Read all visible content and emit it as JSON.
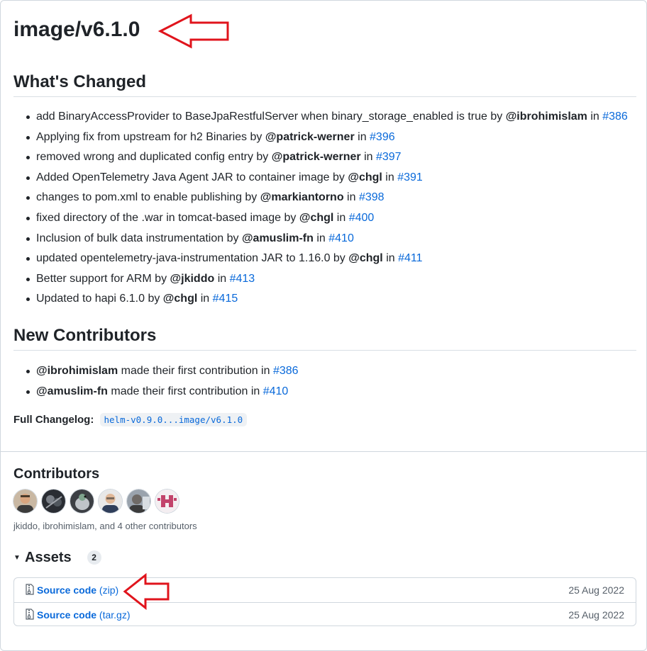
{
  "release": {
    "title": "image/v6.1.0"
  },
  "whats_changed": {
    "heading": "What's Changed",
    "items": [
      {
        "text": "add BinaryAccessProvider to BaseJpaRestfulServer when binary_storage_enabled is true by ",
        "author": "@ibrohimislam",
        "in": " in ",
        "pr": "#386"
      },
      {
        "text": "Applying fix from upstream for h2 Binaries by ",
        "author": "@patrick-werner",
        "in": " in ",
        "pr": "#396"
      },
      {
        "text": "removed wrong and duplicated config entry by ",
        "author": "@patrick-werner",
        "in": " in ",
        "pr": "#397"
      },
      {
        "text": "Added OpenTelemetry Java Agent JAR to container image by ",
        "author": "@chgl",
        "in": " in ",
        "pr": "#391"
      },
      {
        "text": "changes to pom.xml to enable publishing by ",
        "author": "@markiantorno",
        "in": " in ",
        "pr": "#398"
      },
      {
        "text": "fixed directory of the .war in tomcat-based image by ",
        "author": "@chgl",
        "in": " in ",
        "pr": "#400"
      },
      {
        "text": "Inclusion of bulk data instrumentation by ",
        "author": "@amuslim-fn",
        "in": " in ",
        "pr": "#410"
      },
      {
        "text": "updated opentelemetry-java-instrumentation JAR to 1.16.0 by ",
        "author": "@chgl",
        "in": " in ",
        "pr": "#411"
      },
      {
        "text": "Better support for ARM by ",
        "author": "@jkiddo",
        "in": " in ",
        "pr": "#413"
      },
      {
        "text": "Updated to hapi 6.1.0 by ",
        "author": "@chgl",
        "in": " in ",
        "pr": "#415"
      }
    ]
  },
  "new_contributors": {
    "heading": "New Contributors",
    "items": [
      {
        "author": "@ibrohimislam",
        "text": " made their first contribution in ",
        "pr": "#386"
      },
      {
        "author": "@amuslim-fn",
        "text": " made their first contribution in ",
        "pr": "#410"
      }
    ]
  },
  "changelog": {
    "label": "Full Changelog:",
    "link": "helm-v0.9.0...image/v6.1.0"
  },
  "contributors": {
    "heading": "Contributors",
    "summary": "jkiddo, ibrohimislam, and 4 other contributors",
    "avatar_count": 6
  },
  "assets": {
    "heading": "Assets",
    "count": "2",
    "items": [
      {
        "name": "Source code",
        "ext": "(zip)",
        "date": "25 Aug 2022"
      },
      {
        "name": "Source code",
        "ext": "(tar.gz)",
        "date": "25 Aug 2022"
      }
    ]
  },
  "colors": {
    "link": "#0969da",
    "text": "#1f2328",
    "muted": "#57606a",
    "annotation_arrow": "#e0141c"
  },
  "icons": {
    "assets_toggle": "triangle-down-icon",
    "asset_file": "file-zip-icon",
    "annotation": "red-arrow-icon"
  }
}
